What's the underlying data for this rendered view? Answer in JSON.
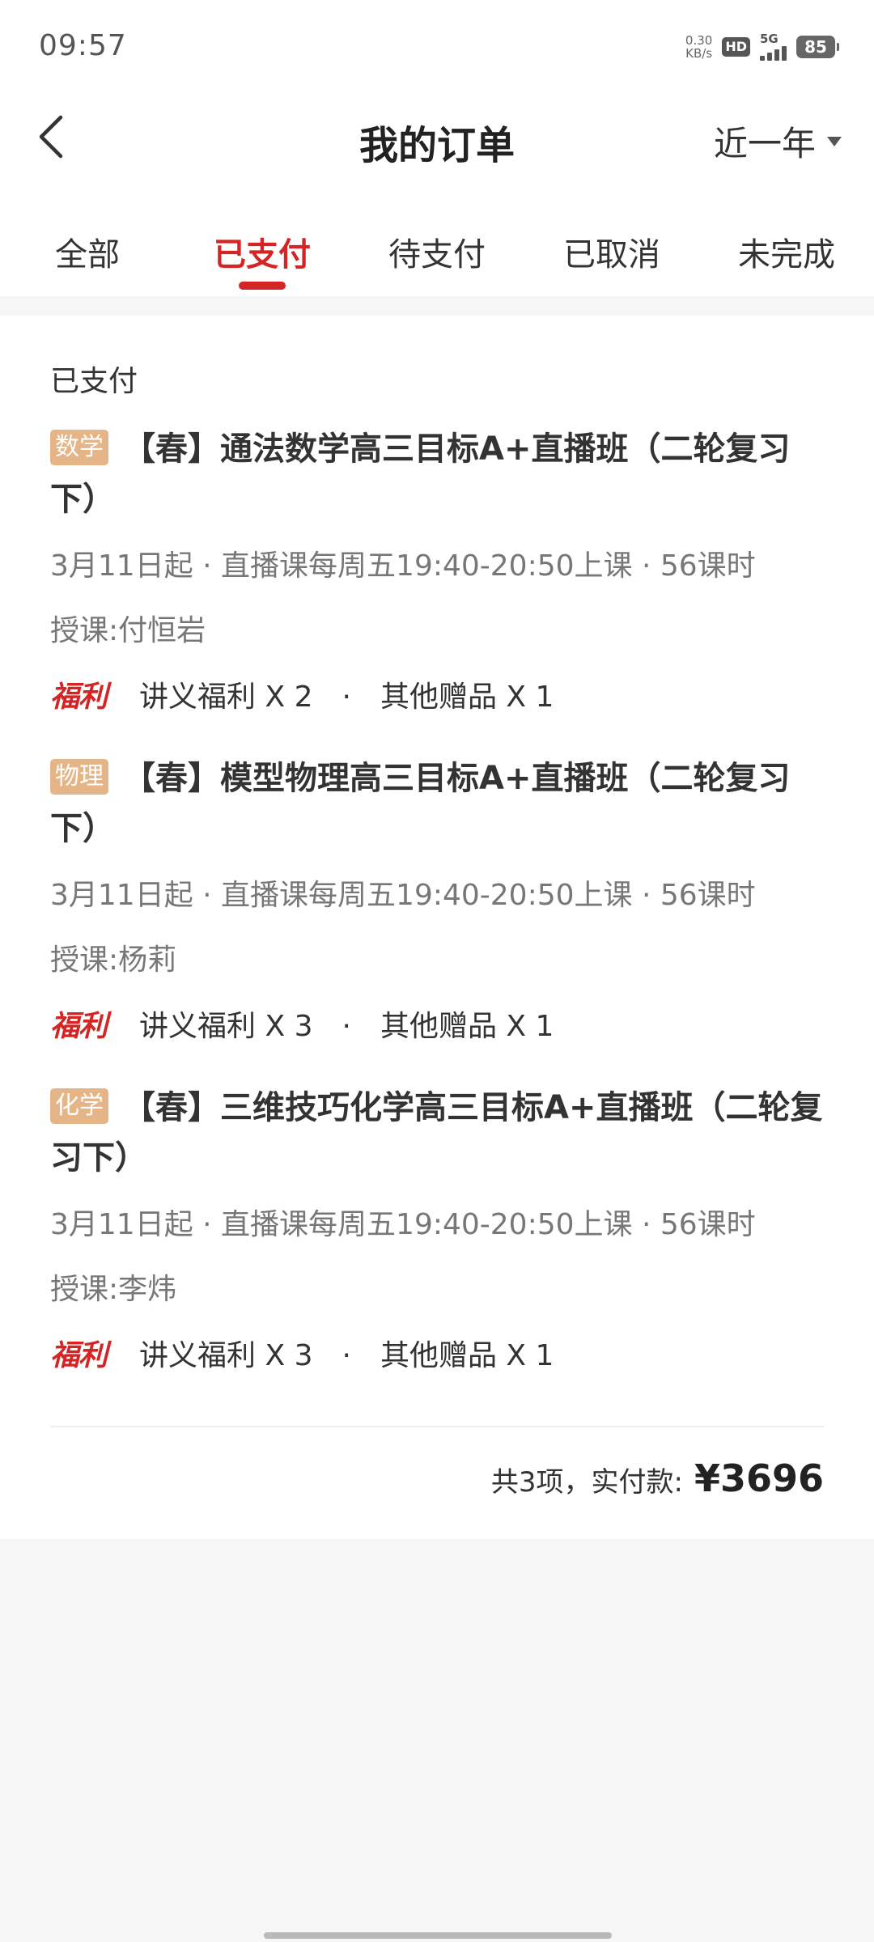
{
  "status": {
    "time": "09:57",
    "net_speed_value": "0.30",
    "net_speed_unit": "KB/s",
    "hd": "HD",
    "signal": "5G",
    "battery": "85"
  },
  "header": {
    "title": "我的订单",
    "range": "近一年"
  },
  "tabs": [
    {
      "label": "全部"
    },
    {
      "label": "已支付"
    },
    {
      "label": "待支付"
    },
    {
      "label": "已取消"
    },
    {
      "label": "未完成"
    }
  ],
  "order": {
    "status": "已支付",
    "courses": [
      {
        "subject": "数学",
        "title": "【春】通法数学高三目标A+直播班（二轮复习下）",
        "schedule": "3月11日起 · 直播课每周五19:40-20:50上课 · 56课时",
        "teacher": "授课:付恒岩",
        "perk_label": "福利",
        "perk_handout": "讲义福利 X 2",
        "perk_dot": "·",
        "perk_gift": "其他赠品 X 1"
      },
      {
        "subject": "物理",
        "title": "【春】模型物理高三目标A+直播班（二轮复习下）",
        "schedule": "3月11日起 · 直播课每周五19:40-20:50上课 · 56课时",
        "teacher": "授课:杨莉",
        "perk_label": "福利",
        "perk_handout": "讲义福利 X 3",
        "perk_dot": "·",
        "perk_gift": "其他赠品 X 1"
      },
      {
        "subject": "化学",
        "title": "【春】三维技巧化学高三目标A+直播班（二轮复习下）",
        "schedule": "3月11日起 · 直播课每周五19:40-20:50上课 · 56课时",
        "teacher": "授课:李炜",
        "perk_label": "福利",
        "perk_handout": "讲义福利 X 3",
        "perk_dot": "·",
        "perk_gift": "其他赠品 X 1"
      }
    ],
    "total_label": "共3项，实付款:",
    "total_price": "¥3696"
  },
  "colors": {
    "accent": "#d42424",
    "subject_tag": "#e6b587"
  }
}
